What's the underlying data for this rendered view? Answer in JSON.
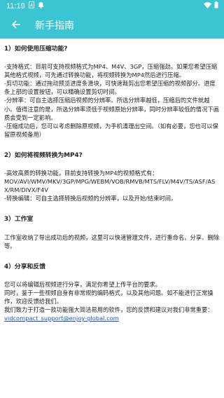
{
  "status": {
    "time": "11:19",
    "icons": [
      "sim-a-icon",
      "notification-icon",
      "wifi-icon",
      "battery-icon"
    ]
  },
  "toolbar": {
    "title": "新手指南",
    "back_icon": "arrow-left-icon",
    "background": "#3bc4d2"
  },
  "sections": [
    {
      "heading": "1）如何使用压缩功能?",
      "body": "-支持格式：目前可支持视频格式为MP4、M4V、3GP，压缩强劲。如果您希望压缩其他格式视频，可先通过转换功能，将视频转换为MP4然后进行压缩。\n-剪切功能：通过拖动预览进度条滑块，可快速裁剪出您希望压缩的视频部分。进度条上部的设置按钮，可以精确设置剪切时间。\n-分辨率：可自主选择压缩后视频的分辨率。所选分辨率越低，压缩后的文件就越小。值得注意的是，所选分辨率须低于视频原始分辨率，同时分辨率较低的情况下画质会受到一定影响。\n-压缩成功后，您可以考虑删除原视频，为手机清理出空间。（如有必要，您也可以保留原视频备用）"
    },
    {
      "heading": "2）如何将视频转换为MP4?",
      "body": "-高效高质的转换功能，目前支持转换为MP4的视频格式有：\nMOV/AVI/WMV/MKV/3GP/MPG/WEBM/VOB/RMVB/MTS/FLV/M4V/TS/ASF/ASX/RM/DIVX/F4V\n-转换编辑：可自主选择转换后视频的分辨率，以及开始/结束时间。"
    },
    {
      "heading": "3）工作室",
      "body": "工作室收纳了导出成功后的视频，这里可以快速管理文件，进行重命名、分享、删除等。"
    },
    {
      "heading": "4）分享和反馈",
      "body": "您可以将编辑后视频进行分享，满足你希望上传平台的要求。\n同时，鉴于一些视频自身有非常规的编码格式，以及其他问题。如不能进行正常操作，欢迎反馈给我们。\n我们致力于打造一款功能强大简洁易用的软件，您的反馈和建议对我们非常重要：",
      "email": "vidcompact_support@enjoy-global.com"
    }
  ]
}
